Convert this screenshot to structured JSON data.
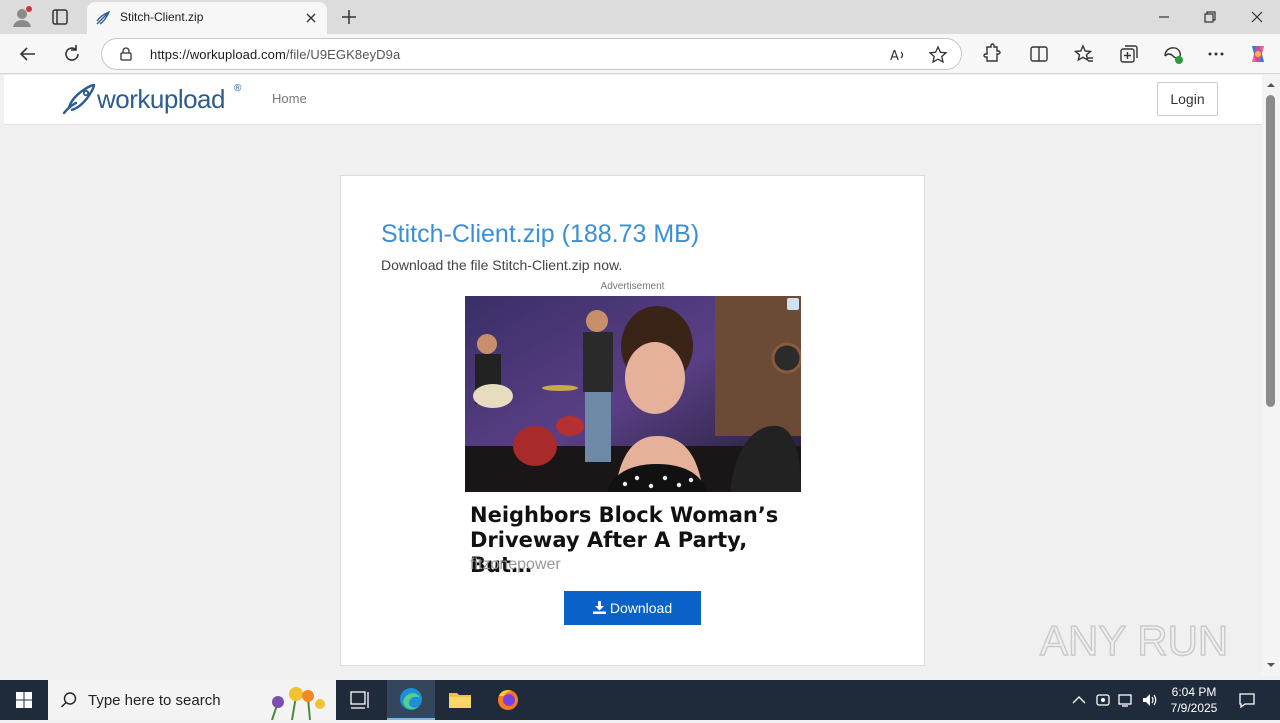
{
  "browser": {
    "tab_title": "Stitch-Client.zip",
    "url_host": "https://workupload.com",
    "url_path": "/file/U9EGK8eyD9a"
  },
  "site": {
    "logo_text": "workupload",
    "logo_mark": "®",
    "nav_home": "Home",
    "login_label": "Login"
  },
  "file": {
    "title": "Stitch-Client.zip (188.73 MB)",
    "subtitle": "Download the file Stitch-Client.zip now."
  },
  "ad": {
    "label": "Advertisement",
    "headline": "Neighbors Block Woman’s Driveway After A Party, But…",
    "source": "fitzonepower"
  },
  "download_label": "Download",
  "watermark_text": "ANY RUN",
  "taskbar": {
    "search_placeholder": "Type here to search",
    "time": "6:04 PM",
    "date": "7/9/2025"
  },
  "colors": {
    "accent": "#3a8fd6",
    "download_button": "#0a62c9",
    "taskbar": "#1f2b3a"
  }
}
